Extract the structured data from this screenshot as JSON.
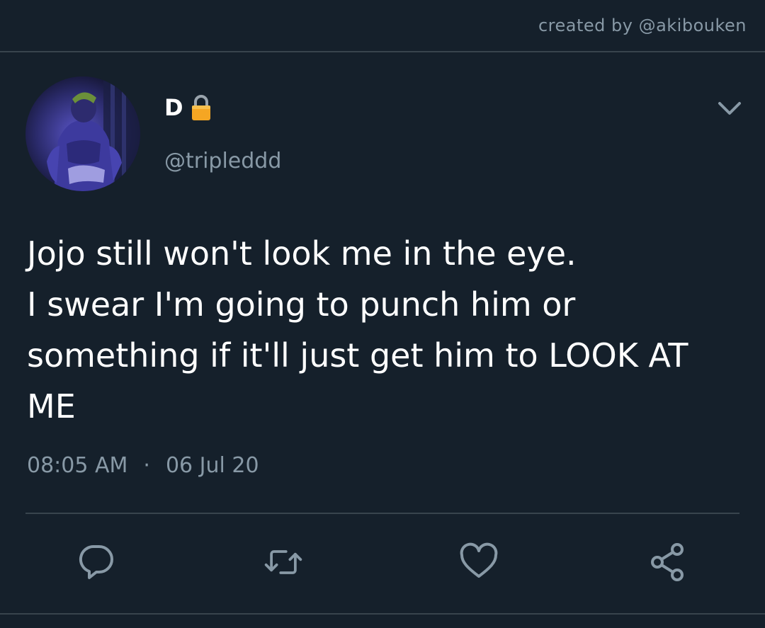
{
  "header": {
    "credit": "created by @akibouken"
  },
  "tweet": {
    "display_name": "D",
    "handle": "@tripleddd",
    "text": "Jojo still won't look me in the eye.\nI swear I'm going to punch him or something if it'll just get him to LOOK AT ME",
    "time": "08:05 AM",
    "separator": "·",
    "date": "06 Jul 20"
  },
  "icons": {
    "lock": "lock-icon",
    "caret": "chevron-down-icon",
    "reply": "reply-icon",
    "retweet": "retweet-icon",
    "like": "heart-icon",
    "share": "share-icon"
  },
  "colors": {
    "background": "#15202b",
    "secondary_text": "#8899a6",
    "divider": "#38444d",
    "lock": "#f5a623"
  }
}
